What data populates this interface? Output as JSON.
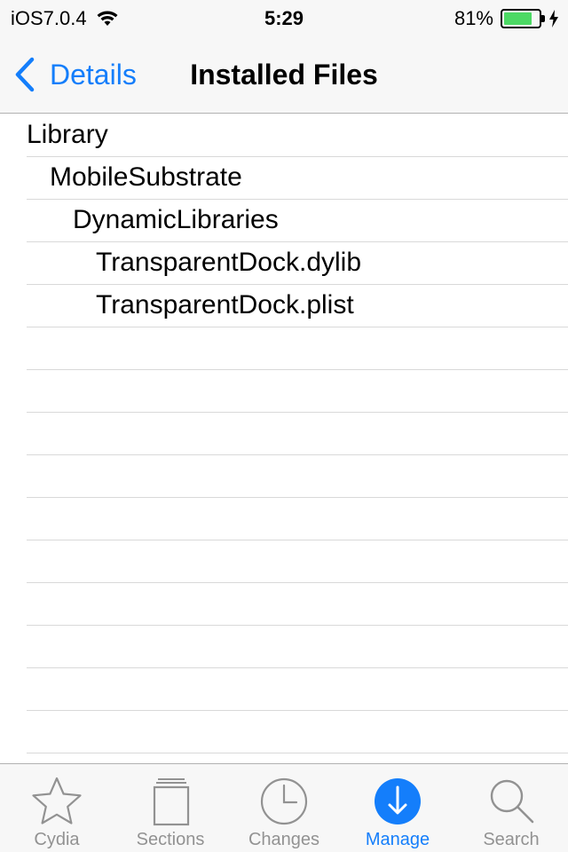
{
  "status_bar": {
    "carrier": "iOS7.0.4",
    "time": "5:29",
    "battery_percent": "81%",
    "battery_level": 0.81,
    "icons": [
      "wifi-icon",
      "battery-icon",
      "charging-bolt-icon"
    ]
  },
  "nav": {
    "back_label": "Details",
    "title": "Installed Files"
  },
  "files": [
    {
      "name": "Library",
      "depth": 0
    },
    {
      "name": "MobileSubstrate",
      "depth": 1
    },
    {
      "name": "DynamicLibraries",
      "depth": 2
    },
    {
      "name": "TransparentDock.dylib",
      "depth": 3
    },
    {
      "name": "TransparentDock.plist",
      "depth": 3
    }
  ],
  "tabs": [
    {
      "label": "Cydia",
      "icon": "star-icon",
      "active": false
    },
    {
      "label": "Sections",
      "icon": "sections-icon",
      "active": false
    },
    {
      "label": "Changes",
      "icon": "clock-icon",
      "active": false
    },
    {
      "label": "Manage",
      "icon": "download-icon",
      "active": true
    },
    {
      "label": "Search",
      "icon": "search-icon",
      "active": false
    }
  ],
  "colors": {
    "accent": "#147efb",
    "battery": "#4cd964",
    "inactive_tab": "#929292",
    "separator": "#d9d9d9"
  }
}
